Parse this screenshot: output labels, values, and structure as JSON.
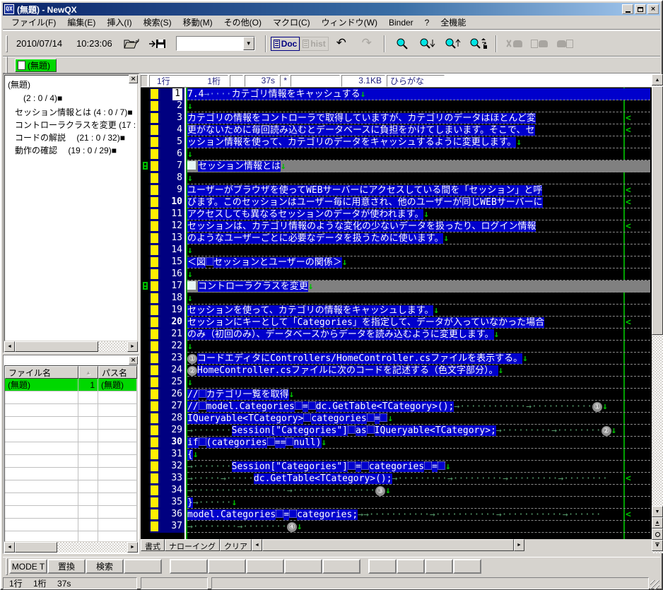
{
  "window": {
    "title": "(無題) - NewQX",
    "controls": {
      "minimize": "_",
      "maximize": "□",
      "close": "×"
    }
  },
  "menu": {
    "items": [
      "ファイル(F)",
      "編集(E)",
      "挿入(I)",
      "検索(S)",
      "移動(M)",
      "その他(O)",
      "マクロ(C)",
      "ウィンドウ(W)",
      "Binder",
      "?",
      "全機能"
    ]
  },
  "toolbar": {
    "date": "2010/07/14",
    "time": "10:23:06",
    "combo_value": "",
    "doc_label": "Doc",
    "hist_label": "hist",
    "undo_glyph": "↶",
    "redo_glyph": "↷",
    "icons": [
      "open-file-icon",
      "save-file-icon",
      "doc-list-icon",
      "hist-list-icon",
      "undo-icon",
      "redo-icon",
      "search-icon",
      "search-down-icon",
      "search-up-icon",
      "search-options-icon",
      "cut-icon",
      "copy-icon",
      "paste-icon"
    ]
  },
  "doc_tab": {
    "label": "(無題)"
  },
  "outline": {
    "header": "(無題)",
    "items": [
      "(2 : 0 / 4)■",
      "セッション情報とは (4 : 0 / 7)■",
      "コントローラクラスを変更 (17 : 0 /",
      "コードの解説　 (21 : 0 / 32)■",
      "動作の確認　 (19 : 0 / 29)■"
    ]
  },
  "file_list": {
    "headers": [
      "ファイル名",
      "",
      "パス名"
    ],
    "sort_icon": "▲",
    "rows": [
      [
        "(無題)",
        "1",
        "(無題)"
      ]
    ],
    "empty_row_count": 12
  },
  "editor": {
    "status": {
      "line": "1行",
      "col": "1桁",
      "box2": "",
      "sel": "37s",
      "mod": "*",
      "box5": "",
      "size": "3.1KB",
      "ime": "ひらがな"
    },
    "marks": {
      "newline": "↓",
      "continuation": "<",
      "heading_square": "■"
    },
    "tabs": [
      "書式",
      "ナローイング",
      "クリア"
    ],
    "lines": [
      {
        "n": 1,
        "row": "blue",
        "cur": true,
        "segs": [
          [
            "t",
            "7.4"
          ],
          [
            "tab",
            "→····"
          ],
          [
            "t",
            "カテゴリ情報をキャッシュする"
          ],
          [
            "nl"
          ]
        ]
      },
      {
        "n": 2,
        "segs": [
          [
            "nl"
          ]
        ]
      },
      {
        "n": 3,
        "segs": [
          [
            "t",
            "カテゴリの情報をコントローラで取得していますが、カテゴリのデータはほとんど変"
          ],
          [
            "cont"
          ]
        ]
      },
      {
        "n": 4,
        "segs": [
          [
            "t",
            "更がないために毎回読み込むとデータベースに負担をかけてしまいます。そこで、セ"
          ],
          [
            "cont"
          ]
        ]
      },
      {
        "n": 5,
        "segs": [
          [
            "t",
            "ッション情報を使って、カテゴリのデータをキャッシュするように変更します。"
          ],
          [
            "nl"
          ]
        ]
      },
      {
        "n": 6,
        "segs": [
          [
            "nl"
          ]
        ]
      },
      {
        "n": 7,
        "row": "gray",
        "mark": true,
        "segs": [
          [
            "sq"
          ],
          [
            "t",
            "セッション情報とは"
          ],
          [
            "nl"
          ]
        ]
      },
      {
        "n": 8,
        "segs": [
          [
            "nl"
          ]
        ]
      },
      {
        "n": 9,
        "segs": [
          [
            "t",
            "ユーザーがブラウザを使ってWEBサーバーにアクセスしている間を「セッション」と呼"
          ],
          [
            "cont"
          ]
        ]
      },
      {
        "n": 10,
        "segs": [
          [
            "t",
            "びます。このセッションはユーザー毎に用意され、他のユーザーが同じWEBサーバーに"
          ],
          [
            "cont"
          ]
        ]
      },
      {
        "n": 11,
        "segs": [
          [
            "t",
            "アクセスしても異なるセッションのデータが使われます。"
          ],
          [
            "nl"
          ]
        ]
      },
      {
        "n": 12,
        "segs": [
          [
            "t",
            "セッションは、カテゴリ情報のような変化の少ないデータを扱ったり、ログイン情報"
          ],
          [
            "cont"
          ]
        ]
      },
      {
        "n": 13,
        "segs": [
          [
            "t",
            "のようなユーザーごとに必要なデータを扱うために使います。"
          ],
          [
            "nl"
          ]
        ]
      },
      {
        "n": 14,
        "segs": [
          [
            "nl"
          ]
        ]
      },
      {
        "n": 15,
        "segs": [
          [
            "t",
            "＜図"
          ],
          [
            "sp"
          ],
          [
            "t",
            "セッションとユーザーの関係＞"
          ],
          [
            "nl"
          ]
        ]
      },
      {
        "n": 16,
        "segs": [
          [
            "nl"
          ]
        ]
      },
      {
        "n": 17,
        "row": "gray",
        "mark": true,
        "segs": [
          [
            "sq"
          ],
          [
            "t",
            "コントローラクラスを変更"
          ],
          [
            "nl"
          ]
        ]
      },
      {
        "n": 18,
        "segs": [
          [
            "nl"
          ]
        ]
      },
      {
        "n": 19,
        "segs": [
          [
            "t",
            "セッションを使って、カテゴリの情報をキャッシュします。"
          ],
          [
            "nl"
          ]
        ]
      },
      {
        "n": 20,
        "segs": [
          [
            "t",
            "セッションにキーとして「Categories」を指定して、データが入っていなかった場合"
          ],
          [
            "cont"
          ]
        ]
      },
      {
        "n": 21,
        "segs": [
          [
            "t",
            "のみ（初回のみ）、データベースからデータを読み込むように変更します。"
          ],
          [
            "nl"
          ]
        ]
      },
      {
        "n": 22,
        "segs": [
          [
            "nl"
          ]
        ]
      },
      {
        "n": 23,
        "segs": [
          [
            "num",
            "①"
          ],
          [
            "t",
            "コードエディタにControllers/HomeController.csファイルを表示する。"
          ],
          [
            "nl"
          ]
        ]
      },
      {
        "n": 24,
        "segs": [
          [
            "num",
            "②"
          ],
          [
            "t",
            "HomeController.csファイルに次のコードを記述する（色文字部分）。"
          ],
          [
            "nl"
          ]
        ]
      },
      {
        "n": 25,
        "segs": [
          [
            "nl"
          ]
        ]
      },
      {
        "n": 26,
        "segs": [
          [
            "t",
            "//"
          ],
          [
            "sp"
          ],
          [
            "t",
            "カテゴリ一覧を取得"
          ],
          [
            "nl"
          ]
        ]
      },
      {
        "n": 27,
        "segs": [
          [
            "t",
            "//"
          ],
          [
            "sp"
          ],
          [
            "t",
            "model.Categories"
          ],
          [
            "sp"
          ],
          [
            "t",
            "="
          ],
          [
            "sp"
          ],
          [
            "t",
            "dc.GetTable<TCategory>();"
          ],
          [
            "tab",
            "→············→···········"
          ],
          [
            "num",
            "①"
          ],
          [
            "nl"
          ]
        ]
      },
      {
        "n": 28,
        "segs": [
          [
            "t",
            "IQueryable<TCategory>"
          ],
          [
            "sp"
          ],
          [
            "t",
            "categories"
          ],
          [
            "sp"
          ],
          [
            "t",
            "="
          ],
          [
            "sp"
          ],
          [
            "nl"
          ]
        ]
      },
      {
        "n": 29,
        "segs": [
          [
            "tab",
            "→·······"
          ],
          [
            "t",
            "Session[\"Categories\"]"
          ],
          [
            "sp"
          ],
          [
            "t",
            "as"
          ],
          [
            "sp"
          ],
          [
            "t",
            "IQueryable<TCategory>;"
          ],
          [
            "tab",
            "→·········→········"
          ],
          [
            "num",
            "②"
          ],
          [
            "nl"
          ]
        ]
      },
      {
        "n": 30,
        "segs": [
          [
            "t",
            "if"
          ],
          [
            "sp"
          ],
          [
            "t",
            "(categories"
          ],
          [
            "sp"
          ],
          [
            "t",
            "=="
          ],
          [
            "sp"
          ],
          [
            "t",
            "null)"
          ],
          [
            "nl"
          ]
        ]
      },
      {
        "n": 31,
        "segs": [
          [
            "t",
            "{"
          ],
          [
            "nl"
          ]
        ]
      },
      {
        "n": 32,
        "segs": [
          [
            "tab",
            "→·······"
          ],
          [
            "t",
            "Session[\"Categories\"]"
          ],
          [
            "sp"
          ],
          [
            "t",
            "="
          ],
          [
            "sp"
          ],
          [
            "t",
            "categories"
          ],
          [
            "sp"
          ],
          [
            "t",
            "="
          ],
          [
            "sp"
          ],
          [
            "nl"
          ]
        ]
      },
      {
        "n": 33,
        "segs": [
          [
            "tab",
            "→·····→·····"
          ],
          [
            "t",
            "dc.GetTable<TCategory>();"
          ],
          [
            "tab",
            "→·········→·········→·········→········"
          ],
          [
            "cont"
          ]
        ]
      },
      {
        "n": 34,
        "segs": [
          [
            "tab",
            "→·················→···············"
          ],
          [
            "num",
            "③"
          ],
          [
            "nl"
          ]
        ]
      },
      {
        "n": 35,
        "segs": [
          [
            "t",
            "}"
          ],
          [
            "tab",
            "→······"
          ],
          [
            "nl"
          ]
        ]
      },
      {
        "n": 36,
        "segs": [
          [
            "t",
            "model.Categories"
          ],
          [
            "sp"
          ],
          [
            "t",
            "="
          ],
          [
            "sp"
          ],
          [
            "t",
            "categories;"
          ],
          [
            "tab",
            "→→···········→···········→···········→······"
          ],
          [
            "cont"
          ]
        ]
      },
      {
        "n": 37,
        "segs": [
          [
            "tab",
            "→········→········"
          ],
          [
            "num",
            "④"
          ],
          [
            "nl"
          ]
        ]
      }
    ]
  },
  "bottom_bar": {
    "buttons": [
      "MODE T",
      "置換",
      "検索",
      "",
      "",
      "",
      "",
      "",
      "",
      "",
      "",
      "",
      ""
    ]
  },
  "status_bar": {
    "left": "1行　 1桁　 37s",
    "mid": "",
    "right": ""
  },
  "colors": {
    "editor_text_bg": "#0000cc",
    "heading_row": "#808080",
    "gutter": "#000080",
    "mark_green": "#00c000",
    "active_tab_green": "#00d800",
    "edited_line_mark": "#ffee00"
  }
}
